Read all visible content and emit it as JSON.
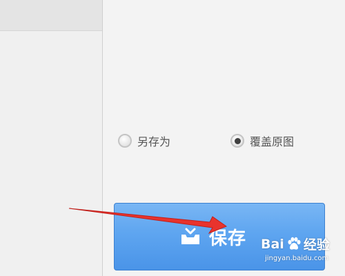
{
  "options": {
    "save_as_label": "另存为",
    "overwrite_label": "覆盖原图",
    "selected": "overwrite"
  },
  "save_button": {
    "label": "保存",
    "icon": "tray-icon"
  },
  "watermark": {
    "brand_left": "Bai",
    "brand_right": "经验",
    "url": "jingyan.baidu.com"
  },
  "colors": {
    "button_top": "#79b6f4",
    "button_bottom": "#4a94e8",
    "arrow": "#e8332d",
    "radio_dot": "#404040"
  }
}
